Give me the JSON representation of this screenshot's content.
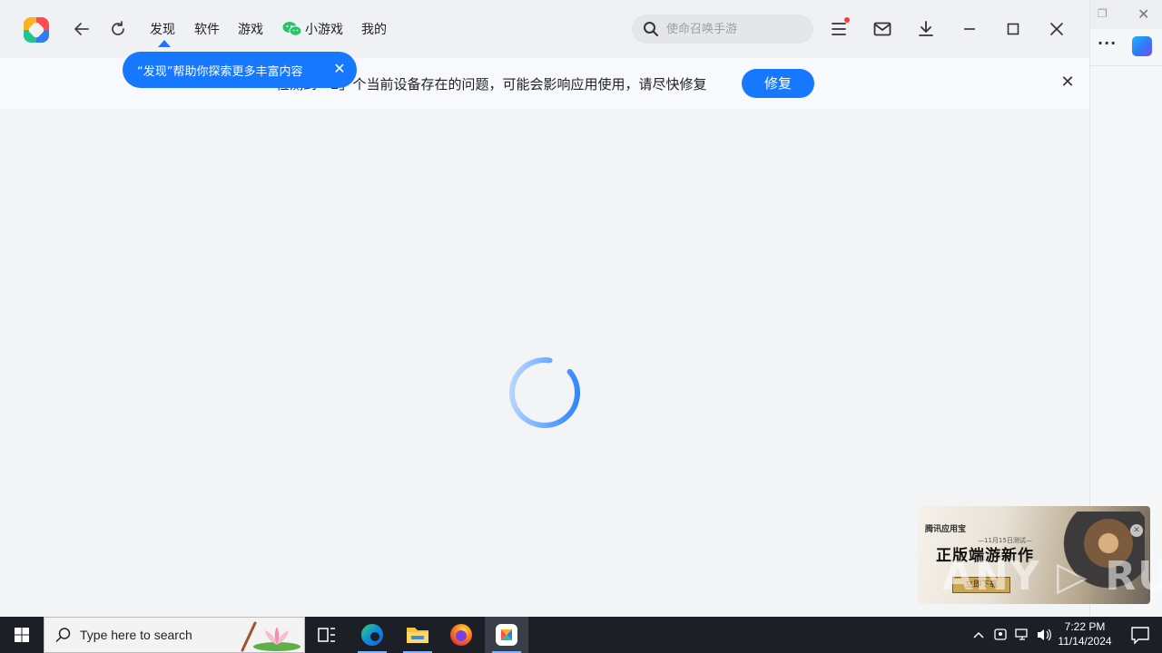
{
  "nav": {
    "items": [
      "发现",
      "软件",
      "游戏",
      "小游戏",
      "我的"
    ]
  },
  "search": {
    "placeholder": "使命召唤手游"
  },
  "notice": {
    "text": "检测到「2」个当前设备存在的问题，可能会影响应用使用，请尽快修复",
    "repair_label": "修复",
    "close_glyph": "✕"
  },
  "tooltip": {
    "text": "“发现”帮助你探索更多丰富内容",
    "close_glyph": "✕"
  },
  "ad": {
    "brand": "腾讯应用宝",
    "date": "—11月15日测试—",
    "title": "正版端游新作",
    "download_label": "立即下载",
    "close_glyph": "✕",
    "watermark": "ANY ▷ RUN"
  },
  "taskbar": {
    "search_placeholder": "Type here to search",
    "time": "7:22 PM",
    "date": "11/14/2024"
  },
  "colors": {
    "accent": "#1677ff",
    "taskbar": "#1c1f26",
    "notification_dot": "#ff3b30"
  },
  "icons": {
    "titlebar": [
      "back-arrow-icon",
      "refresh-icon",
      "wechat-icon",
      "search-icon",
      "menu-icon",
      "mail-icon",
      "download-icon",
      "minimize-icon",
      "maximize-icon",
      "close-icon"
    ],
    "taskbar": [
      "windows-start-icon",
      "search-icon",
      "task-view-icon",
      "edge-icon",
      "file-explorer-icon",
      "firefox-icon",
      "app-store-icon",
      "chevron-up-icon",
      "meet-icon",
      "network-icon",
      "volume-icon",
      "notification-icon"
    ]
  }
}
